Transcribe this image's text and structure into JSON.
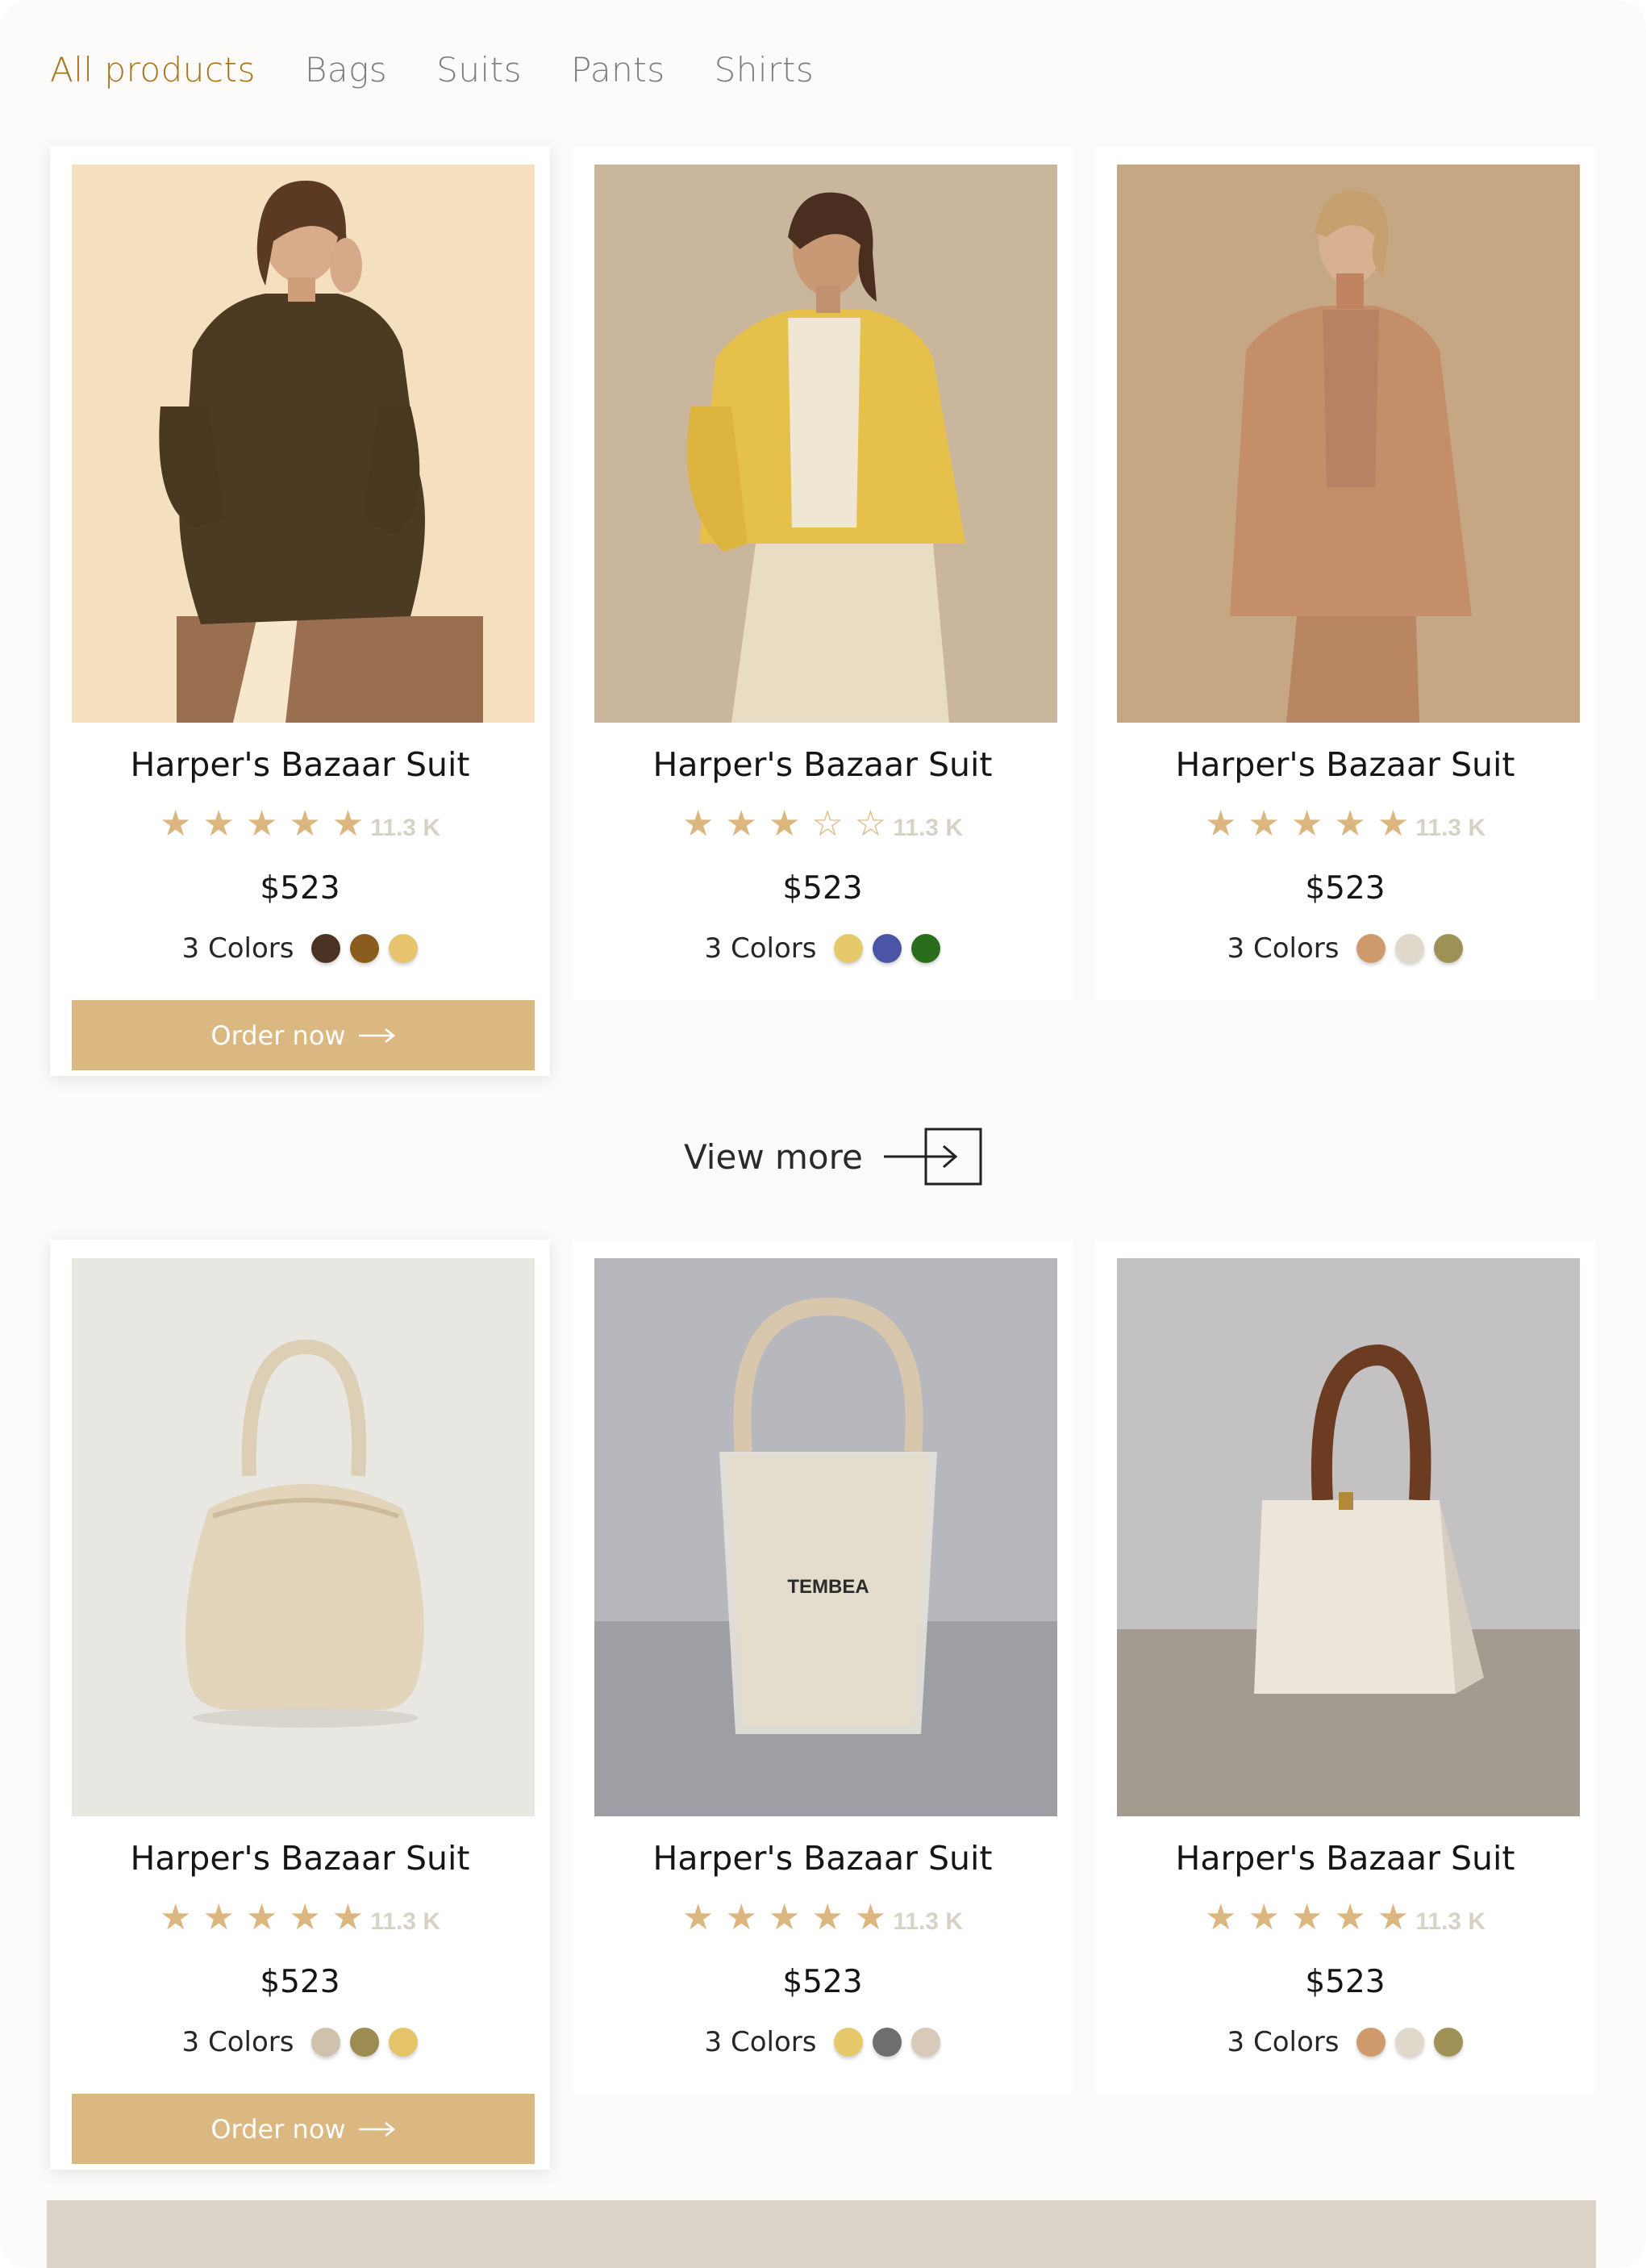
{
  "tabs": [
    "All products",
    "Bags",
    "Suits",
    "Pants",
    "Shirts"
  ],
  "active_tab": "All products",
  "view_more_label": "View more",
  "row1": [
    {
      "title": "Harper's Bazaar Suit",
      "rating": 5,
      "reviews": "11.3 K",
      "price": "$523",
      "colors_label": "3 Colors",
      "colors": [
        "#4a3322",
        "#8a5c1e",
        "#e6c56e"
      ],
      "order_label": "Order now",
      "image": "woman in brown oversized blouse and brown trousers"
    },
    {
      "title": "Harper's Bazaar Suit",
      "rating": 3,
      "reviews": "11.3 K",
      "price": "$523",
      "colors_label": "3 Colors",
      "colors": [
        "#e6c96a",
        "#4b55a5",
        "#2a6e1c"
      ],
      "image": "woman in yellow blazer and cream trousers"
    },
    {
      "title": "Harper's Bazaar Suit",
      "rating": 5,
      "reviews": "11.3 K",
      "price": "$523",
      "colors_label": "3 Colors",
      "colors": [
        "#cf9a6c",
        "#e0d9cb",
        "#9f9257"
      ],
      "image": "woman in camel knit cardigan"
    }
  ],
  "row2": [
    {
      "title": "Harper's Bazaar Suit",
      "rating": 5,
      "reviews": "11.3 K",
      "price": "$523",
      "colors_label": "3 Colors",
      "colors": [
        "#cfc1ab",
        "#9c8c51",
        "#e6c46a"
      ],
      "order_label": "Order now",
      "image": "cream ruched handbag"
    },
    {
      "title": "Harper's Bazaar Suit",
      "rating": 5,
      "reviews": "11.3 K",
      "price": "$523",
      "colors_label": "3 Colors",
      "colors": [
        "#e6c96a",
        "#6e6e6e",
        "#d8c9b9"
      ],
      "image": "canvas tote in clear bag",
      "bag_print": "TEMBEA"
    },
    {
      "title": "Harper's Bazaar Suit",
      "rating": 5,
      "reviews": "11.3 K",
      "price": "$523",
      "colors_label": "3 Colors",
      "colors": [
        "#cf9a6c",
        "#e0d9cb",
        "#9f9257"
      ],
      "image": "cream structured bag with brown handle"
    }
  ]
}
